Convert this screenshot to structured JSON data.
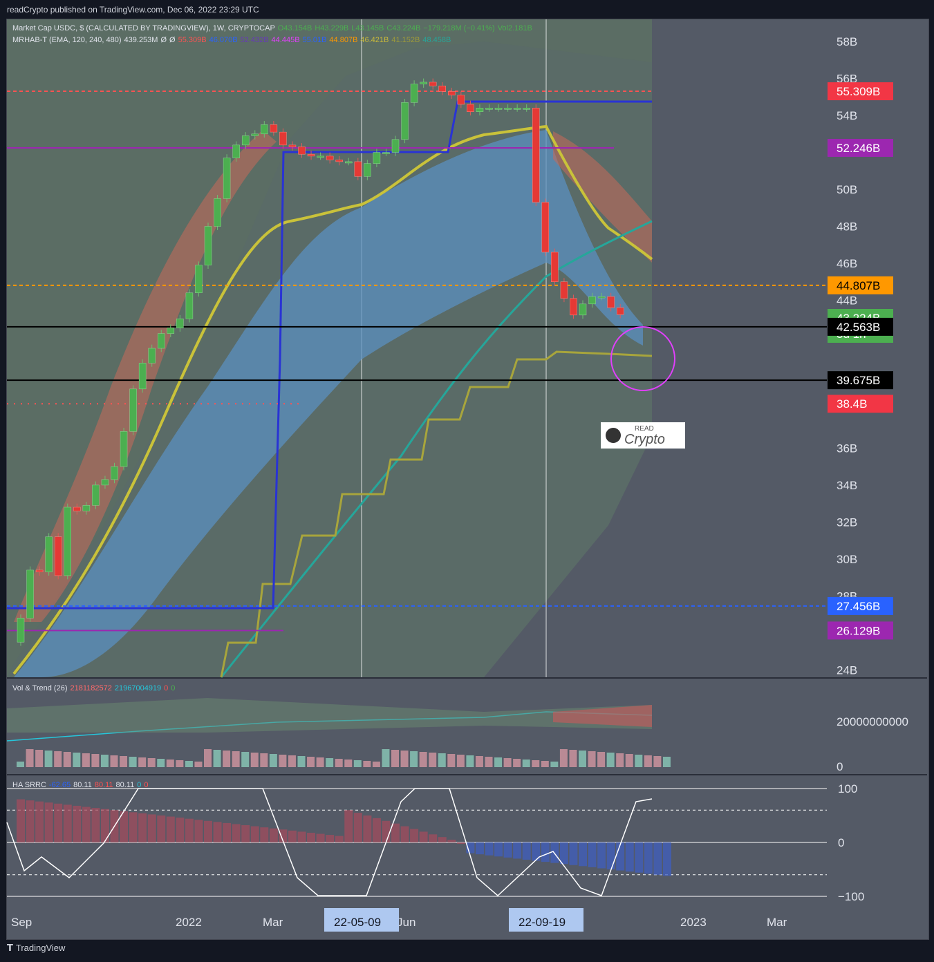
{
  "header": {
    "published": "readCrypto published on TradingView.com, Dec 06, 2022 23:29 UTC"
  },
  "legend_main": {
    "symbol": "Market Cap USDC, $ (CALCULATED BY TRADINGVIEW), 1W, CRYPTOCAP",
    "o": "O43.154B",
    "h": "H43.229B",
    "l": "L43.145B",
    "c": "C43.224B",
    "chg": "−179.218M (−0.41%)",
    "vol": "Vol2.181B"
  },
  "legend_ind": {
    "name": "MRHAB-T (EMA, 120, 240, 480)",
    "v1": "439.253M",
    "z1": "Ø",
    "z2": "Ø",
    "vals": [
      {
        "t": "55.309B",
        "c": "#ff5252"
      },
      {
        "t": "46.070B",
        "c": "#2962ff"
      },
      {
        "t": "52.432B",
        "c": "#673ab7"
      },
      {
        "t": "44.445B",
        "c": "#e040fb"
      },
      {
        "t": "55.01B",
        "c": "#2962ff"
      },
      {
        "t": "44.807B",
        "c": "#ff9800"
      },
      {
        "t": "46.421B",
        "c": "#c9b93a"
      },
      {
        "t": "41.152B",
        "c": "#9e9a3a"
      },
      {
        "t": "48.458B",
        "c": "#26a69a"
      }
    ]
  },
  "legend_vol": {
    "name": "Vol & Trend (26)",
    "a": "2181182572",
    "b": "21967004919",
    "c": "0",
    "d": "0"
  },
  "legend_ha": {
    "name": "HA SRRC",
    "a": "-62.65",
    "b": "80.11",
    "c": "80.11",
    "d": "80.11",
    "e": "0",
    "f": "0"
  },
  "y_axis": {
    "ticks": [
      "58B",
      "56B",
      "54B",
      "50B",
      "48B",
      "46B",
      "44B",
      "36B",
      "34B",
      "32B",
      "30B",
      "28B",
      "24B"
    ],
    "labels": [
      {
        "text": "55.309B",
        "bg": "#f23645",
        "fg": "#ffffff"
      },
      {
        "text": "52.246B",
        "bg": "#9c27b0",
        "fg": "#ffffff"
      },
      {
        "text": "44.807B",
        "bg": "#ff9800",
        "fg": "#000000"
      },
      {
        "text": "43.224B",
        "bg": "#4caf50",
        "fg": "#ffffff"
      },
      {
        "text": "5d 1h",
        "bg": "#4caf50",
        "fg": "#ffffff"
      },
      {
        "text": "42.563B",
        "bg": "#000000",
        "fg": "#ffffff"
      },
      {
        "text": "39.675B",
        "bg": "#000000",
        "fg": "#ffffff"
      },
      {
        "text": "38.4B",
        "bg": "#f23645",
        "fg": "#ffffff"
      },
      {
        "text": "27.456B",
        "bg": "#2962ff",
        "fg": "#ffffff"
      },
      {
        "text": "26.129B",
        "bg": "#9c27b0",
        "fg": "#ffffff"
      }
    ],
    "vol_ticks": [
      "20000000000",
      "0"
    ],
    "ha_ticks": [
      "100",
      "0",
      "−100"
    ]
  },
  "x_axis": {
    "ticks": [
      "Sep",
      "2022",
      "Mar",
      "Jun",
      "2023",
      "Mar"
    ],
    "highlighted": [
      "22-05-09",
      "22-09-19"
    ]
  },
  "watermark": {
    "top": "READ",
    "main": "Crypto"
  },
  "footer": {
    "brand": "TradingView"
  },
  "chart_data": {
    "type": "candlestick",
    "title": "Market Cap USDC, $ (CALCULATED BY TRADINGVIEW), 1W, CRYPTOCAP",
    "ylim": [
      23.6,
      59.2
    ],
    "close_series_B": [
      26.8,
      29.4,
      29.3,
      31.2,
      29.1,
      32.8,
      32.6,
      32.9,
      34.0,
      34.3,
      35.0,
      36.9,
      39.2,
      40.6,
      41.4,
      42.2,
      42.5,
      43.0,
      44.4,
      45.9,
      48.0,
      49.5,
      51.7,
      52.4,
      52.9,
      53.0,
      53.5,
      53.1,
      52.4,
      52.3,
      51.9,
      51.8,
      51.8,
      51.6,
      51.5,
      51.5,
      50.7,
      51.4,
      52.0,
      52.0,
      52.7,
      54.7,
      55.7,
      55.8,
      55.6,
      55.3,
      55.1,
      54.6,
      54.2,
      54.4,
      54.4,
      54.4,
      54.4,
      54.4,
      54.4,
      49.3,
      46.6,
      45.0,
      44.1,
      43.2,
      43.8,
      44.2,
      44.2,
      43.6,
      43.224
    ],
    "horizontal_levels_B": [
      55.309,
      52.246,
      44.807,
      42.563,
      39.675,
      38.4,
      27.456,
      26.129
    ],
    "volume_panel": {
      "ylim": [
        0,
        30000000000
      ]
    },
    "ha_srrc_panel": {
      "ylim": [
        -100,
        100
      ]
    }
  }
}
